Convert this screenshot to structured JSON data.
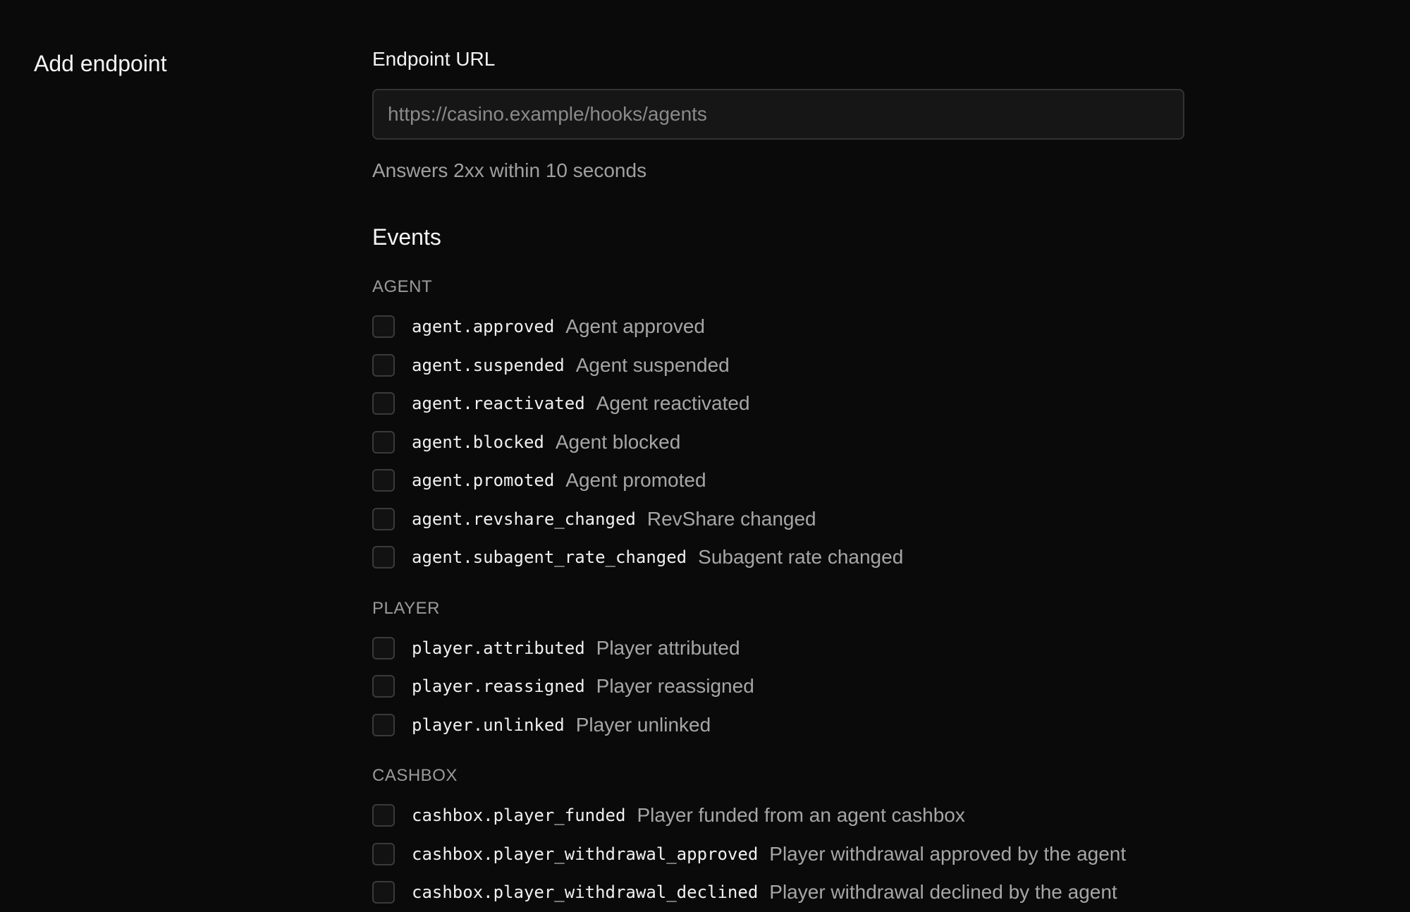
{
  "section": {
    "title": "Add endpoint"
  },
  "endpoint": {
    "label": "Endpoint URL",
    "placeholder": "https://casino.example/hooks/agents",
    "hint": "Answers 2xx within 10 seconds"
  },
  "events": {
    "title": "Events",
    "groups": [
      {
        "name": "AGENT",
        "items": [
          {
            "code": "agent.approved",
            "desc": "Agent approved"
          },
          {
            "code": "agent.suspended",
            "desc": "Agent suspended"
          },
          {
            "code": "agent.reactivated",
            "desc": "Agent reactivated"
          },
          {
            "code": "agent.blocked",
            "desc": "Agent blocked"
          },
          {
            "code": "agent.promoted",
            "desc": "Agent promoted"
          },
          {
            "code": "agent.revshare_changed",
            "desc": "RevShare changed"
          },
          {
            "code": "agent.subagent_rate_changed",
            "desc": "Subagent rate changed"
          }
        ]
      },
      {
        "name": "PLAYER",
        "items": [
          {
            "code": "player.attributed",
            "desc": "Player attributed"
          },
          {
            "code": "player.reassigned",
            "desc": "Player reassigned"
          },
          {
            "code": "player.unlinked",
            "desc": "Player unlinked"
          }
        ]
      },
      {
        "name": "CASHBOX",
        "items": [
          {
            "code": "cashbox.player_funded",
            "desc": "Player funded from an agent cashbox"
          },
          {
            "code": "cashbox.player_withdrawal_approved",
            "desc": "Player withdrawal approved by the agent"
          },
          {
            "code": "cashbox.player_withdrawal_declined",
            "desc": "Player withdrawal declined by the agent"
          }
        ]
      }
    ]
  }
}
